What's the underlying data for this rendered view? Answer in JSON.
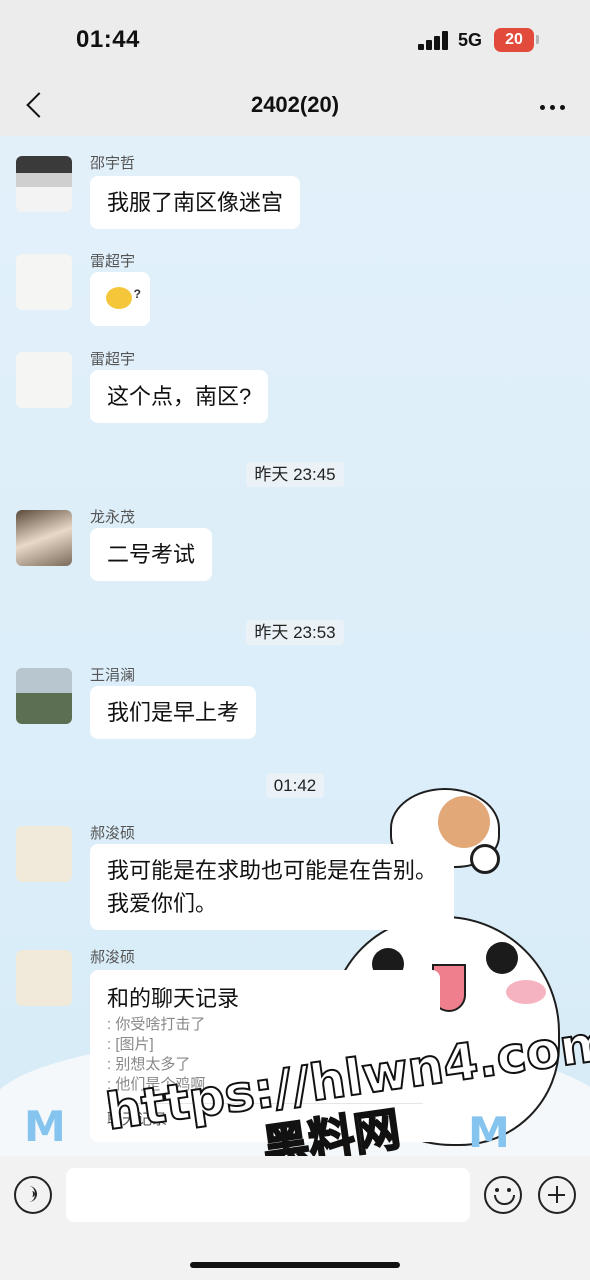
{
  "status_bar": {
    "time": "01:44",
    "network": "5G",
    "battery": "20",
    "signal_icon": "signal-bars-icon",
    "battery_color": "#e24a3b"
  },
  "header": {
    "title": "2402(20)",
    "back_icon": "chevron-left-icon",
    "more_icon": "ellipsis-icon"
  },
  "messages": [
    {
      "sender": "邵宇哲",
      "text": "我服了南区像迷宫"
    },
    {
      "sender": "雷超宇",
      "text": "",
      "emoji": "confused-face-emoji"
    },
    {
      "sender": "雷超宇",
      "text": "这个点，南区?"
    },
    {
      "sender": "龙永茂",
      "text": "二号考试"
    },
    {
      "sender": "王涓澜",
      "text": "我们是早上考"
    },
    {
      "sender": "郝浚硕",
      "lines": [
        "我可能是在求助也可能是在告别。",
        "我爱你们。"
      ]
    },
    {
      "sender": "郝浚硕",
      "record": {
        "title": "和的聊天记录",
        "lines": [
          ": 你受啥打击了",
          ": [图片]",
          ": 别想太多了",
          ": 他们是个鸡啊..."
        ],
        "footer": "聊天记录"
      }
    }
  ],
  "timestamps": [
    "昨天 23:45",
    "昨天 23:53",
    "01:42"
  ],
  "watermark": {
    "url": "https://hlwn4.com",
    "name": "黑料网"
  },
  "input_bar": {
    "placeholder": "",
    "voice_icon": "voice-icon",
    "emoji_icon": "emoji-icon",
    "plus_icon": "plus-icon"
  }
}
